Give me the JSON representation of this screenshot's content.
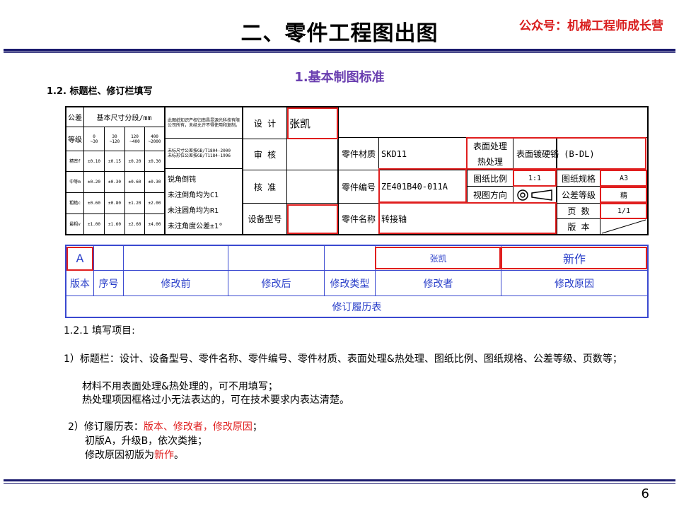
{
  "header": {
    "title": "二、零件工程图出图",
    "brand": "公众号：机械工程师成长营"
  },
  "subtitle": "1.基本制图标准",
  "section_title": "1.2. 标题栏、修订栏填写",
  "title_block": {
    "tol_header_1": "公差",
    "tol_header_2": "基本尺寸分段/mm",
    "grade_label": "等级",
    "range_1": "0\n~30",
    "range_2": "30\n~120",
    "range_3": "120\n~400",
    "range_4": "400\n~2000",
    "rows": [
      {
        "label": "精密f",
        "v": [
          "±0.10",
          "±0.15",
          "±0.20",
          "±0.30"
        ]
      },
      {
        "label": "中等m",
        "v": [
          "±0.20",
          "±0.30",
          "±0.60",
          "±0.30"
        ]
      },
      {
        "label": "粗糙c",
        "v": [
          "±0.60",
          "±0.80",
          "±1.20",
          "±2.00"
        ]
      },
      {
        "label": "最粗v",
        "v": [
          "±1.00",
          "±1.60",
          "±2.60",
          "±4.00"
        ]
      }
    ],
    "ip_notice": "此图纸知识产权归南昌昱源光科技有限公司所有，未经允许不得使用和复制。",
    "std_note": "未标尺寸公差按GB/T1804-2000\n未标形位公差按GB/T1184-1996",
    "notes": [
      "锐角倒钝",
      "未注倒角均为C1",
      "未注圆角均为R1",
      "未注角度公差±1°"
    ],
    "design_label": "设  计",
    "design_value": "张凯",
    "review_label": "审  核",
    "approve_label": "核  准",
    "equipment_label": "设备型号",
    "material_label": "零件材质",
    "material_value": "SKD11",
    "part_no_label": "零件编号",
    "part_no_value": "ZE401B40-011A",
    "part_name_label": "零件名称",
    "part_name_value": "转接轴",
    "surface_label_1": "表面处理",
    "surface_label_2": "热处理",
    "surface_value": "表面镀硬铬 (B-DL)",
    "scale_label": "图纸比例",
    "scale_value": "1:1",
    "sheet_size_label": "图纸规格",
    "sheet_size_value": "A3",
    "view_label": "视图方向",
    "tol_grade_label": "公差等级",
    "tol_grade_value": "精",
    "pages_label": "页  数",
    "pages_value": "1/1",
    "version_label": "版  本"
  },
  "revision_table": {
    "version_value": "A",
    "reviser_value": "张凯",
    "reason_value": "新作",
    "headers": [
      "版本",
      "序号",
      "修改前",
      "修改后",
      "修改类型",
      "修改者",
      "修改原因"
    ],
    "footer": "修订履历表"
  },
  "body": {
    "heading": "1.2.1 填写项目:",
    "item1": "1）标题栏：设计、设备型号、零件名称、零件编号、零件材质、表面处理&热处理、图纸比例、图纸规格、公差等级、页数等；",
    "item1_a": "材料不用表面处理&热处理的，可不用填写；",
    "item1_b": "热处理项因框格过小无法表达的，可在技术要求内表达清楚。",
    "item2_prefix": "2）修订履历表：",
    "item2_red": "版本、修改者，修改原因",
    "item2_suffix": "；",
    "item2_a": "初版A，升级B，依次类推；",
    "item2_b_prefix": "修改原因初版为",
    "item2_b_red": "新作",
    "item2_b_suffix": "。"
  },
  "page_number": "6"
}
